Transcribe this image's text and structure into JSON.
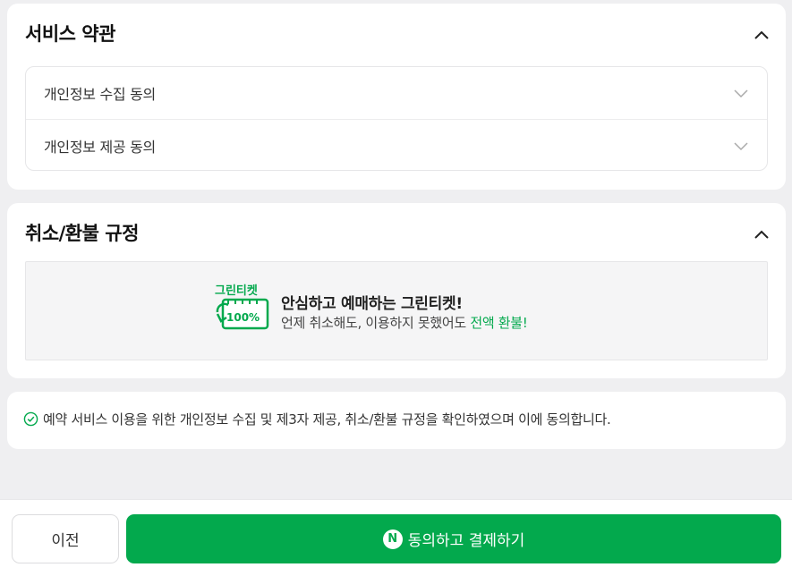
{
  "terms_section": {
    "title": "서비스 약관",
    "items": [
      {
        "label": "개인정보 수집 동의"
      },
      {
        "label": "개인정보 제공 동의"
      }
    ]
  },
  "refund_section": {
    "title": "취소/환불 규정",
    "banner": {
      "logo_text": "그린티켓",
      "logo_badge": "100%",
      "title": "안심하고 예매하는 그린티켓!",
      "subtitle_prefix": "언제 취소해도, 이용하지 못했어도 ",
      "subtitle_highlight": "전액 환불!"
    }
  },
  "agreement": {
    "text": "예약 서비스 이용을 위한 개인정보 수집 및 제3자 제공, 취소/환불 규정을 확인하였으며 이에 동의합니다."
  },
  "footer": {
    "prev_label": "이전",
    "pay_badge": "N",
    "pay_label": "동의하고 결제하기"
  },
  "colors": {
    "accent": "#03a94d",
    "background": "#efeff1"
  }
}
